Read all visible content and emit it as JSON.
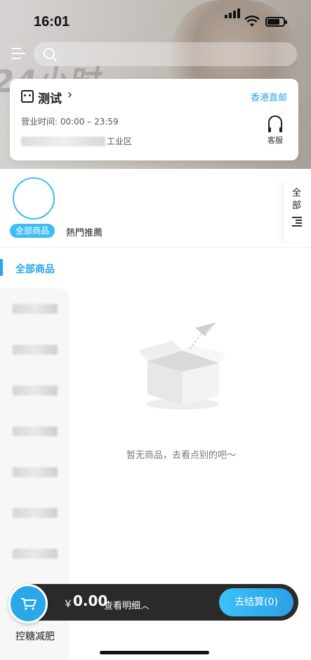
{
  "status_bar": {
    "time": "16:01",
    "battery_level": 0.75
  },
  "hero": {
    "banner_text": "24小时"
  },
  "search": {
    "placeholder": ""
  },
  "store": {
    "name": "测试",
    "hq_label": "香港直邮",
    "hours": "营业时间: 00:00 – 23:59",
    "address_suffix": "工业区",
    "service_label": "客服"
  },
  "categories": {
    "selected_chip": "全部商品",
    "secondary": "熱門推薦",
    "all_side_label": "全部"
  },
  "section": {
    "title": "全部商品"
  },
  "sidebar": {
    "last_label": "控糖减肥"
  },
  "empty_state": {
    "text": "暂无商品，去看点别的吧～"
  },
  "cart": {
    "currency": "￥",
    "total": "0.00",
    "detail_label": "查看明细︿",
    "checkout_label": "去结算(0)"
  },
  "colors": {
    "accent": "#2aa7e8",
    "cart_bar": "#2a2a2a"
  }
}
